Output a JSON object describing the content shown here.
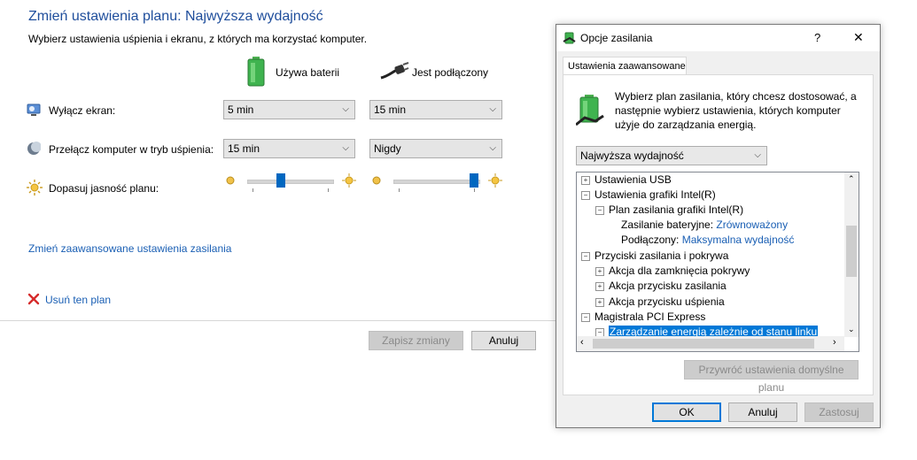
{
  "main": {
    "title": "Zmień ustawienia planu: Najwyższa wydajność",
    "subtitle": "Wybierz ustawienia uśpienia i ekranu, z których ma korzystać komputer.",
    "col_battery": "Używa baterii",
    "col_plugged": "Jest podłączony",
    "rows": [
      {
        "label": "Wyłącz ekran:",
        "battery": "5 min",
        "plugged": "15 min"
      },
      {
        "label": "Przełącz komputer w tryb uśpienia:",
        "battery": "15 min",
        "plugged": "Nigdy"
      },
      {
        "label": "Dopasuj jasność planu:"
      }
    ],
    "brightness": {
      "battery_fraction": 0.4,
      "plugged_fraction": 0.95
    },
    "advanced_link": "Zmień zaawansowane ustawienia zasilania",
    "delete_link": "Usuń ten plan",
    "save_button": "Zapisz zmiany",
    "cancel_button": "Anuluj"
  },
  "dialog": {
    "title": "Opcje zasilania",
    "help": "?",
    "close": "✕",
    "tab": "Ustawienia zaawansowane",
    "description": "Wybierz plan zasilania, który chcesz dostosować, a następnie wybierz ustawienia, których komputer użyje do zarządzania energią.",
    "plan_selected": "Najwyższa wydajność",
    "tree": [
      {
        "pm": "+",
        "text": "Ustawienia USB"
      },
      {
        "pm": "−",
        "text": "Ustawienia grafiki Intel(R)"
      },
      {
        "pm": "−",
        "text": "Plan zasilania grafiki Intel(R)"
      },
      {
        "key": "Zasilanie bateryjne:",
        "value": "Zrównoważony"
      },
      {
        "key": "Podłączony:",
        "value": "Maksymalna wydajność"
      },
      {
        "pm": "−",
        "text": "Przyciski zasilania i pokrywa"
      },
      {
        "pm": "+",
        "text": "Akcja dla zamknięcia pokrywy"
      },
      {
        "pm": "+",
        "text": "Akcja przycisku zasilania"
      },
      {
        "pm": "+",
        "text": "Akcja przycisku uśpienia"
      },
      {
        "pm": "−",
        "text": "Magistrala PCI Express"
      },
      {
        "pm": "−",
        "text": "Zarządzanie energią zależnie od stanu linku"
      }
    ],
    "restore_button": "Przywróć ustawienia domyślne planu",
    "ok_button": "OK",
    "cancel_button": "Anuluj",
    "apply_button": "Zastosuj"
  },
  "colors": {
    "accent": "#0078d7",
    "link": "#1a5fb4",
    "title": "#1f4e9c",
    "selection": "#0078d7"
  }
}
